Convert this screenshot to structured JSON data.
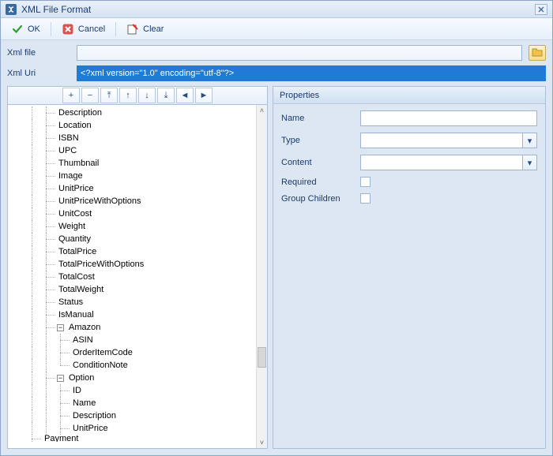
{
  "window": {
    "title": "XML File Format"
  },
  "toolbar": {
    "ok": "OK",
    "cancel": "Cancel",
    "clear": "Clear"
  },
  "form": {
    "xml_file_label": "Xml file",
    "xml_file_value": "",
    "xml_uri_label": "Xml Uri",
    "xml_uri_value": "<?xml version=\"1.0\" encoding=\"utf-8\"?>"
  },
  "tree_toolbar": {
    "add": "+",
    "remove": "−",
    "move_top": "⤒",
    "move_up": "↑",
    "move_down": "↓",
    "move_bottom": "⤓",
    "nav_left": "◄",
    "nav_right": "►"
  },
  "tree": [
    {
      "depth": 2,
      "label": "Description"
    },
    {
      "depth": 2,
      "label": "Location"
    },
    {
      "depth": 2,
      "label": "ISBN"
    },
    {
      "depth": 2,
      "label": "UPC"
    },
    {
      "depth": 2,
      "label": "Thumbnail"
    },
    {
      "depth": 2,
      "label": "Image"
    },
    {
      "depth": 2,
      "label": "UnitPrice"
    },
    {
      "depth": 2,
      "label": "UnitPriceWithOptions"
    },
    {
      "depth": 2,
      "label": "UnitCost"
    },
    {
      "depth": 2,
      "label": "Weight"
    },
    {
      "depth": 2,
      "label": "Quantity"
    },
    {
      "depth": 2,
      "label": "TotalPrice"
    },
    {
      "depth": 2,
      "label": "TotalPriceWithOptions"
    },
    {
      "depth": 2,
      "label": "TotalCost"
    },
    {
      "depth": 2,
      "label": "TotalWeight"
    },
    {
      "depth": 2,
      "label": "Status"
    },
    {
      "depth": 2,
      "label": "IsManual"
    },
    {
      "depth": 2,
      "label": "Amazon",
      "expander": "−"
    },
    {
      "depth": 3,
      "label": "ASIN"
    },
    {
      "depth": 3,
      "label": "OrderItemCode"
    },
    {
      "depth": 3,
      "label": "ConditionNote",
      "end_of_group": true
    },
    {
      "depth": 2,
      "label": "Option",
      "expander": "−"
    },
    {
      "depth": 3,
      "label": "ID"
    },
    {
      "depth": 3,
      "label": "Name"
    },
    {
      "depth": 3,
      "label": "Description"
    },
    {
      "depth": 3,
      "label": "UnitPrice"
    },
    {
      "depth": 1,
      "label": "Payment",
      "partial": true
    }
  ],
  "properties": {
    "header": "Properties",
    "fields": {
      "name_label": "Name",
      "type_label": "Type",
      "content_label": "Content",
      "required_label": "Required",
      "group_children_label": "Group Children"
    },
    "values": {
      "name": "",
      "type": "",
      "content": "",
      "required": false,
      "group_children": false
    }
  }
}
